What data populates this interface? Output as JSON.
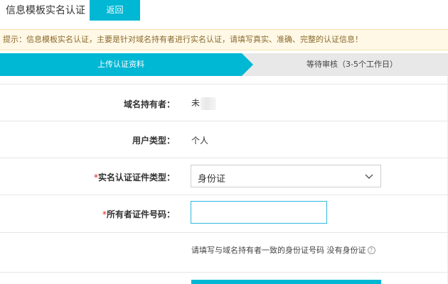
{
  "header": {
    "title": "信息模板实名认证",
    "back_label": "返回"
  },
  "tip": {
    "text": "提示：信息模板实名认证，主要是针对域名持有者进行实名认证，请填写真实、准确、完整的认证信息！"
  },
  "steps": [
    {
      "label": "上传认证资料",
      "active": true
    },
    {
      "label": "等待审核（3-5个工作日）",
      "active": false
    }
  ],
  "form": {
    "owner": {
      "label": "域名持有者：",
      "value": "未"
    },
    "user_type": {
      "label": "用户类型：",
      "value": "个人"
    },
    "id_type": {
      "required_mark": "*",
      "label": "实名认证证件类型：",
      "selected": "身份证"
    },
    "id_number": {
      "required_mark": "*",
      "label": "所有者证件号码：",
      "value": ""
    },
    "hint": "请填写与域名持有者一致的身份证号码 没有身份证"
  },
  "colors": {
    "accent": "#00b7d4",
    "tip_bg": "#fff8e6",
    "tip_text": "#8a6a2e",
    "required": "#e02020",
    "step_inactive": "#e8e8e8"
  }
}
